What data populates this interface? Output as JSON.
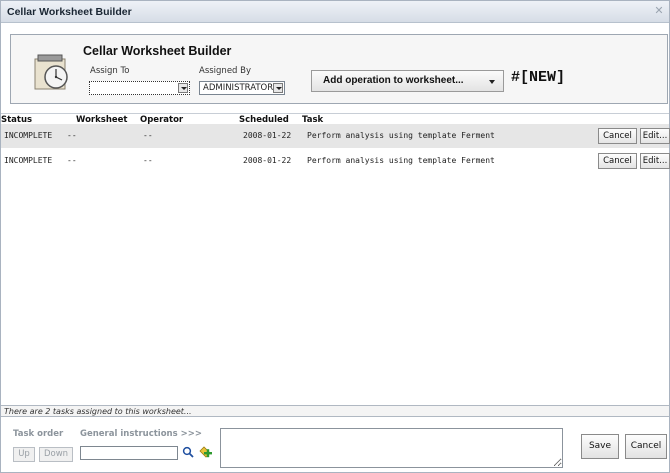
{
  "window": {
    "title": "Cellar Worksheet Builder"
  },
  "header": {
    "title": "Cellar Worksheet Builder",
    "assign_to_label": "Assign To",
    "assigned_by_label": "Assigned By",
    "assign_to_value": "",
    "assigned_by_value": "ADMINISTRATOR, S",
    "add_operation_label": "Add operation to worksheet...",
    "worksheet_id": "#[NEW]"
  },
  "table": {
    "columns": [
      "Status",
      "Worksheet",
      "Operator",
      "Scheduled",
      "Task"
    ],
    "rows": [
      {
        "status": "INCOMPLETE",
        "worksheet": "--",
        "operator": "--",
        "scheduled": "2008-01-22",
        "task": "Perform analysis using template Ferment",
        "cancel": "Cancel",
        "edit": "Edit..."
      },
      {
        "status": "INCOMPLETE",
        "worksheet": "--",
        "operator": "--",
        "scheduled": "2008-01-22",
        "task": "Perform analysis using template Ferment",
        "cancel": "Cancel",
        "edit": "Edit..."
      }
    ]
  },
  "status_text": "There are 2 tasks assigned to this worksheet...",
  "footer": {
    "task_order_label": "Task order",
    "general_instructions_label": "General instructions >>>",
    "up_label": "Up",
    "down_label": "Down",
    "save_label": "Save",
    "cancel_label": "Cancel"
  },
  "icons": {
    "title_close": "close-icon",
    "header": "clock-icon",
    "search": "search-icon",
    "add": "add-icon"
  }
}
